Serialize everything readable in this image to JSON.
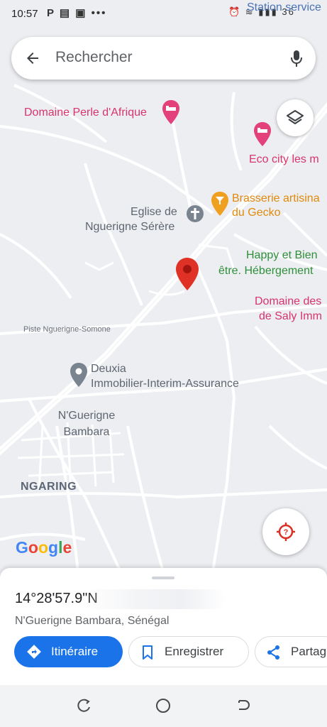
{
  "status_bar": {
    "time": "10:57",
    "notification_icons": "P ▤ ▣ •••",
    "right_icons": "⏰ ≋ ▮▮▮ 36",
    "overlay_label": "Station service"
  },
  "search": {
    "placeholder": "Rechercher",
    "back_icon": "arrow-left-icon",
    "mic_icon": "microphone-icon"
  },
  "map": {
    "labels": {
      "domaine_perle": "Domaine Perle d'Afrique",
      "eco_city": "Eco city les m",
      "brasserie_line1": "Brasserie artisina",
      "brasserie_line2": "du Gecko",
      "eglise_line1": "Eglise de",
      "eglise_line2": "Nguerigne Sérère",
      "happy_line1": "Happy et Bien",
      "happy_line2": "être. Hébergement",
      "domaine_des_line1": "Domaine des",
      "domaine_des_line2": "de Saly Imm",
      "piste": "Piste Nguerigne-Somone",
      "deuxia_line1": "Deuxia",
      "deuxia_line2": "Immobilier-Interim-Assurance",
      "nguerigne_line1": "N'Guerigne",
      "nguerigne_line2": "Bambara",
      "ngaring": "NGARING"
    },
    "google_logo": "Google",
    "colors": {
      "pink_poi": "#d7356b",
      "orange_poi": "#e08a0d",
      "green_poi": "#2f8f3a",
      "grey_poi": "#7a8490",
      "pin": "#e03127"
    }
  },
  "sheet": {
    "coordinates": "14°28'57.9\"N",
    "place": "N'Guerigne Bambara, Sénégal",
    "buttons": {
      "directions": "Itinéraire",
      "save": "Enregistrer",
      "share": "Partager"
    }
  }
}
